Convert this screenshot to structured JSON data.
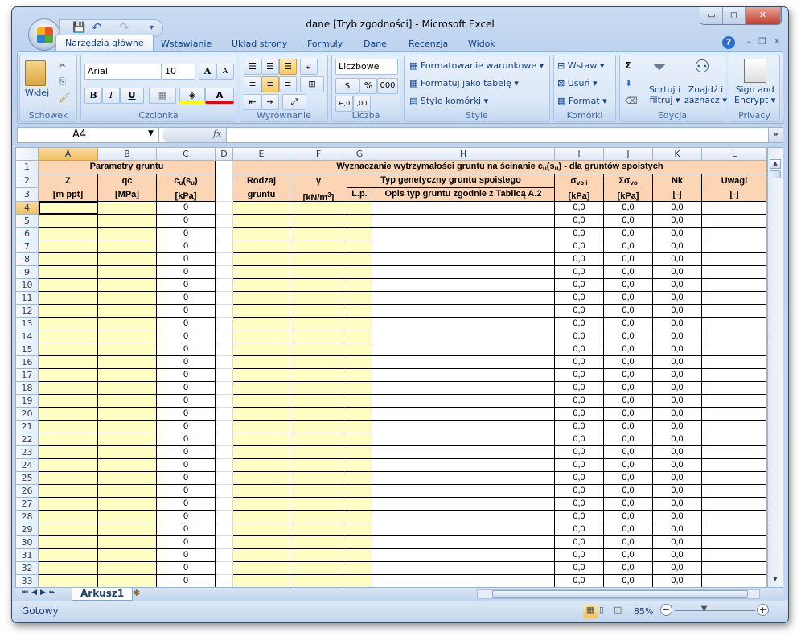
{
  "window": {
    "title": "dane  [Tryb zgodności] - Microsoft Excel",
    "minimize": "▭",
    "restore": "◻",
    "close": "✕"
  },
  "qat": {
    "save": "💾",
    "undo": "↶",
    "redo": "↷",
    "more": "▾"
  },
  "tabs": [
    {
      "label": "Narzędzia główne",
      "active": true
    },
    {
      "label": "Wstawianie"
    },
    {
      "label": "Układ strony"
    },
    {
      "label": "Formuły"
    },
    {
      "label": "Dane"
    },
    {
      "label": "Recenzja"
    },
    {
      "label": "Widok"
    }
  ],
  "ribbon": {
    "clipboard": {
      "label": "Schowek",
      "paste": "Wklej"
    },
    "font": {
      "label": "Czcionka",
      "name": "Arial",
      "size": "10",
      "bold": "B",
      "italic": "I",
      "underline": "U",
      "grow": "A",
      "shrink": "A",
      "fontcolor": "A"
    },
    "align": {
      "label": "Wyrównanie"
    },
    "number": {
      "label": "Liczba",
      "format": "Liczbowe",
      "percent": "%",
      "thousands": "000",
      "inc": "←,0",
      "dec": ",00"
    },
    "styles": {
      "label": "Style",
      "conditional": "Formatowanie warunkowe",
      "as_table": "Formatuj jako tabelę",
      "cell_styles": "Style komórki"
    },
    "cells": {
      "label": "Komórki",
      "insert": "Wstaw",
      "delete": "Usuń",
      "format": "Format"
    },
    "editing": {
      "label": "Edycja",
      "sum": "Σ",
      "sort1": "Sortuj i",
      "sort2": "filtruj",
      "find1": "Znajdź i",
      "find2": "zaznacz"
    },
    "privacy": {
      "label": "Privacy",
      "sign1": "Sign and",
      "sign2": "Encrypt"
    }
  },
  "formula_bar": {
    "name_box": "A4",
    "fx": "fx",
    "value": ""
  },
  "colors": {
    "header_fill": "#fcd5b4",
    "input_fill": "#ffffc3",
    "selected_header": "#f1c15f"
  },
  "columns": [
    "A",
    "B",
    "C",
    "D",
    "E",
    "F",
    "G",
    "H",
    "I",
    "J",
    "K",
    "L"
  ],
  "selected_cell": "A4",
  "headers": {
    "row1_left": "Parametry gruntu",
    "row1_right": {
      "t1": "Wyznaczanie wytrzymałości gruntu na ścinanie c",
      "s1": "u",
      "t2": "(s",
      "s2": "u",
      "t3": ") - dla gruntów spoistych"
    },
    "A": [
      "Z",
      "[m ppt]"
    ],
    "B": [
      "qc",
      "[MPa]"
    ],
    "C": {
      "t1": "c",
      "s1": "u",
      "t2": "(s",
      "s2": "u",
      "t3": ")",
      "unit": "[kPa]"
    },
    "E": [
      "Rodzaj",
      "gruntu"
    ],
    "F": {
      "top": "γ",
      "unit": "[kN/m",
      "sup": "3",
      "end": "]"
    },
    "GH": "Typ genetyczny gruntu spoistego",
    "G": "L.p.",
    "H": "Opis typ gruntu zgodnie z Tablicą A.2",
    "I": {
      "t": "σ",
      "s": "vo i",
      "unit": "[kPa]"
    },
    "J": {
      "t": "Σσ",
      "s": "vo",
      "unit": "[kPa]"
    },
    "K": [
      "Nk",
      "[-]"
    ],
    "L": [
      "Uwagi",
      "[-]"
    ]
  },
  "header_row_numbers": [
    "1",
    "2",
    "3"
  ],
  "rows": [
    {
      "n": "4",
      "C": "0",
      "I": "0,0",
      "J": "0,0",
      "K": "0,0"
    },
    {
      "n": "5",
      "C": "0",
      "I": "0,0",
      "J": "0,0",
      "K": "0,0"
    },
    {
      "n": "6",
      "C": "0",
      "I": "0,0",
      "J": "0,0",
      "K": "0,0"
    },
    {
      "n": "7",
      "C": "0",
      "I": "0,0",
      "J": "0,0",
      "K": "0,0"
    },
    {
      "n": "8",
      "C": "0",
      "I": "0,0",
      "J": "0,0",
      "K": "0,0"
    },
    {
      "n": "9",
      "C": "0",
      "I": "0,0",
      "J": "0,0",
      "K": "0,0"
    },
    {
      "n": "10",
      "C": "0",
      "I": "0,0",
      "J": "0,0",
      "K": "0,0"
    },
    {
      "n": "11",
      "C": "0",
      "I": "0,0",
      "J": "0,0",
      "K": "0,0"
    },
    {
      "n": "12",
      "C": "0",
      "I": "0,0",
      "J": "0,0",
      "K": "0,0"
    },
    {
      "n": "13",
      "C": "0",
      "I": "0,0",
      "J": "0,0",
      "K": "0,0"
    },
    {
      "n": "14",
      "C": "0",
      "I": "0,0",
      "J": "0,0",
      "K": "0,0"
    },
    {
      "n": "15",
      "C": "0",
      "I": "0,0",
      "J": "0,0",
      "K": "0,0"
    },
    {
      "n": "16",
      "C": "0",
      "I": "0,0",
      "J": "0,0",
      "K": "0,0"
    },
    {
      "n": "17",
      "C": "0",
      "I": "0,0",
      "J": "0,0",
      "K": "0,0"
    },
    {
      "n": "18",
      "C": "0",
      "I": "0,0",
      "J": "0,0",
      "K": "0,0"
    },
    {
      "n": "19",
      "C": "0",
      "I": "0,0",
      "J": "0,0",
      "K": "0,0"
    },
    {
      "n": "20",
      "C": "0",
      "I": "0,0",
      "J": "0,0",
      "K": "0,0"
    },
    {
      "n": "21",
      "C": "0",
      "I": "0,0",
      "J": "0,0",
      "K": "0,0"
    },
    {
      "n": "22",
      "C": "0",
      "I": "0,0",
      "J": "0,0",
      "K": "0,0"
    },
    {
      "n": "23",
      "C": "0",
      "I": "0,0",
      "J": "0,0",
      "K": "0,0"
    },
    {
      "n": "24",
      "C": "0",
      "I": "0,0",
      "J": "0,0",
      "K": "0,0"
    },
    {
      "n": "25",
      "C": "0",
      "I": "0,0",
      "J": "0,0",
      "K": "0,0"
    },
    {
      "n": "26",
      "C": "0",
      "I": "0,0",
      "J": "0,0",
      "K": "0,0"
    },
    {
      "n": "27",
      "C": "0",
      "I": "0,0",
      "J": "0,0",
      "K": "0,0"
    },
    {
      "n": "28",
      "C": "0",
      "I": "0,0",
      "J": "0,0",
      "K": "0,0"
    },
    {
      "n": "29",
      "C": "0",
      "I": "0,0",
      "J": "0,0",
      "K": "0,0"
    },
    {
      "n": "30",
      "C": "0",
      "I": "0,0",
      "J": "0,0",
      "K": "0,0"
    },
    {
      "n": "31",
      "C": "0",
      "I": "0,0",
      "J": "0,0",
      "K": "0,0"
    },
    {
      "n": "32",
      "C": "0",
      "I": "0,0",
      "J": "0,0",
      "K": "0,0"
    },
    {
      "n": "33",
      "C": "0",
      "I": "0,0",
      "J": "0,0",
      "K": "0,0"
    }
  ],
  "sheet_tabs": [
    {
      "label": "Arkusz1",
      "active": true
    }
  ],
  "status": {
    "text": "Gotowy",
    "zoom": "85%",
    "zoom_percent": 85
  }
}
